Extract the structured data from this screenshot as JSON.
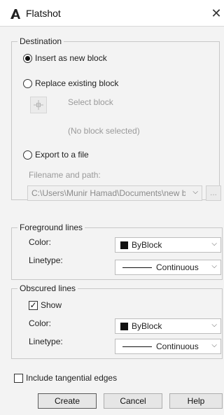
{
  "window": {
    "title": "Flatshot"
  },
  "destination": {
    "legend": "Destination",
    "options": [
      {
        "label": "Insert as new block",
        "selected": true
      },
      {
        "label": "Replace existing block",
        "selected": false
      },
      {
        "label": "Export to a file",
        "selected": false
      }
    ],
    "select_block_label": "Select block",
    "no_block_text": "(No block selected)",
    "filename_label": "Filename and path:",
    "filename_value": "C:\\Users\\Munir Hamad\\Documents\\new blc",
    "browse_label": "..."
  },
  "foreground": {
    "legend": "Foreground lines",
    "color_label": "Color:",
    "color_value": "ByBlock",
    "linetype_label": "Linetype:",
    "linetype_value": "Continuous"
  },
  "obscured": {
    "legend": "Obscured lines",
    "show_label": "Show",
    "show_checked": true,
    "color_label": "Color:",
    "color_value": "ByBlock",
    "linetype_label": "Linetype:",
    "linetype_value": "Continuous"
  },
  "tangential": {
    "label": "Include tangential edges",
    "checked": false
  },
  "buttons": {
    "create": "Create",
    "cancel": "Cancel",
    "help": "Help"
  },
  "colors": {
    "swatch": "#111111",
    "dialog_bg": "#f3f3f3",
    "title_bg": "#ffffff"
  }
}
